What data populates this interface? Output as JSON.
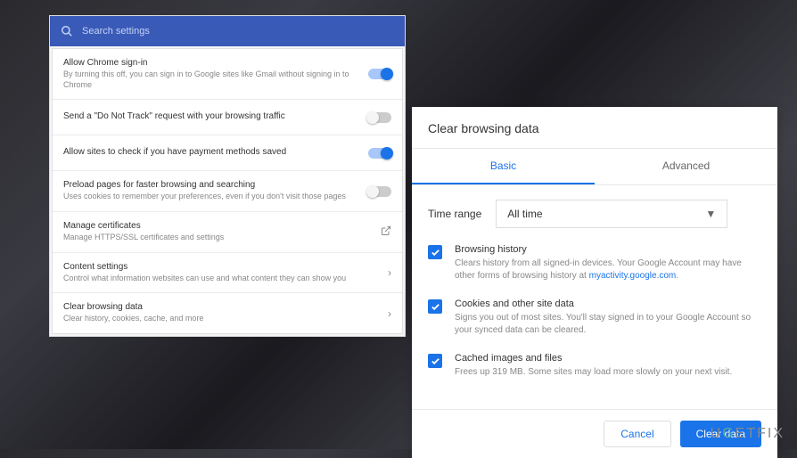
{
  "search": {
    "placeholder": "Search settings"
  },
  "settings": [
    {
      "title": "Allow Chrome sign-in",
      "desc": "By turning this off, you can sign in to Google sites like Gmail without signing in to Chrome",
      "control": "toggle",
      "state": "on"
    },
    {
      "title": "Send a \"Do Not Track\" request with your browsing traffic",
      "desc": "",
      "control": "toggle",
      "state": "off"
    },
    {
      "title": "Allow sites to check if you have payment methods saved",
      "desc": "",
      "control": "toggle",
      "state": "on"
    },
    {
      "title": "Preload pages for faster browsing and searching",
      "desc": "Uses cookies to remember your preferences, even if you don't visit those pages",
      "control": "toggle",
      "state": "off"
    },
    {
      "title": "Manage certificates",
      "desc": "Manage HTTPS/SSL certificates and settings",
      "control": "external"
    },
    {
      "title": "Content settings",
      "desc": "Control what information websites can use and what content they can show you",
      "control": "arrow"
    },
    {
      "title": "Clear browsing data",
      "desc": "Clear history, cookies, cache, and more",
      "control": "arrow"
    }
  ],
  "dialog": {
    "title": "Clear browsing data",
    "tabs": {
      "basic": "Basic",
      "advanced": "Advanced"
    },
    "timeRange": {
      "label": "Time range",
      "value": "All time"
    },
    "options": [
      {
        "title": "Browsing history",
        "desc_pre": "Clears history from all signed-in devices. Your Google Account may have other forms of browsing history at ",
        "link": "myactivity.google.com",
        "desc_post": "."
      },
      {
        "title": "Cookies and other site data",
        "desc": "Signs you out of most sites. You'll stay signed in to your Google Account so your synced data can be cleared."
      },
      {
        "title": "Cached images and files",
        "desc": "Frees up 319 MB. Some sites may load more slowly on your next visit."
      }
    ],
    "buttons": {
      "cancel": "Cancel",
      "clear": "Clear data"
    }
  },
  "watermark": "UGETFIX"
}
